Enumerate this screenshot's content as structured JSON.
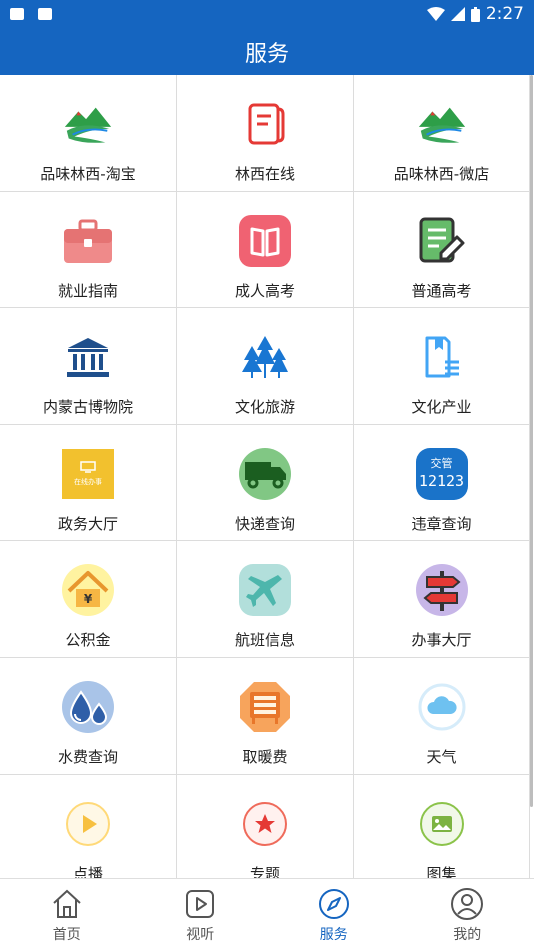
{
  "status": {
    "time": "2:27"
  },
  "header": {
    "title": "服务"
  },
  "services": [
    {
      "label": "品味林西-淘宝",
      "icon": "mountain-logo-icon"
    },
    {
      "label": "林西在线",
      "icon": "notebook-icon"
    },
    {
      "label": "品味林西-微店",
      "icon": "mountain-logo-icon"
    },
    {
      "label": "就业指南",
      "icon": "briefcase-icon"
    },
    {
      "label": "成人高考",
      "icon": "open-book-icon"
    },
    {
      "label": "普通高考",
      "icon": "exam-paper-pen-icon"
    },
    {
      "label": "内蒙古博物院",
      "icon": "museum-icon"
    },
    {
      "label": "文化旅游",
      "icon": "trees-icon"
    },
    {
      "label": "文化产业",
      "icon": "document-list-icon"
    },
    {
      "label": "政务大厅",
      "icon": "online-office-icon"
    },
    {
      "label": "快递查询",
      "icon": "delivery-truck-icon"
    },
    {
      "label": "违章查询",
      "icon": "traffic-12123-icon"
    },
    {
      "label": "公积金",
      "icon": "house-yen-icon"
    },
    {
      "label": "航班信息",
      "icon": "airplane-icon"
    },
    {
      "label": "办事大厅",
      "icon": "signpost-icon"
    },
    {
      "label": "水费查询",
      "icon": "water-drops-icon"
    },
    {
      "label": "取暖费",
      "icon": "radiator-icon"
    },
    {
      "label": "天气",
      "icon": "cloud-icon"
    },
    {
      "label": "点播",
      "icon": "play-icon"
    },
    {
      "label": "专题",
      "icon": "star-icon"
    },
    {
      "label": "图集",
      "icon": "image-icon"
    }
  ],
  "icon_text": {
    "online_office": "在线办事",
    "traffic_top": "交管",
    "traffic_num": "12123"
  },
  "nav": [
    {
      "label": "首页",
      "icon": "home-icon"
    },
    {
      "label": "视听",
      "icon": "video-play-icon"
    },
    {
      "label": "服务",
      "icon": "compass-icon",
      "active": true
    },
    {
      "label": "我的",
      "icon": "user-icon"
    }
  ],
  "colors": {
    "primary": "#1565c0",
    "active_nav": "#1565c0"
  }
}
